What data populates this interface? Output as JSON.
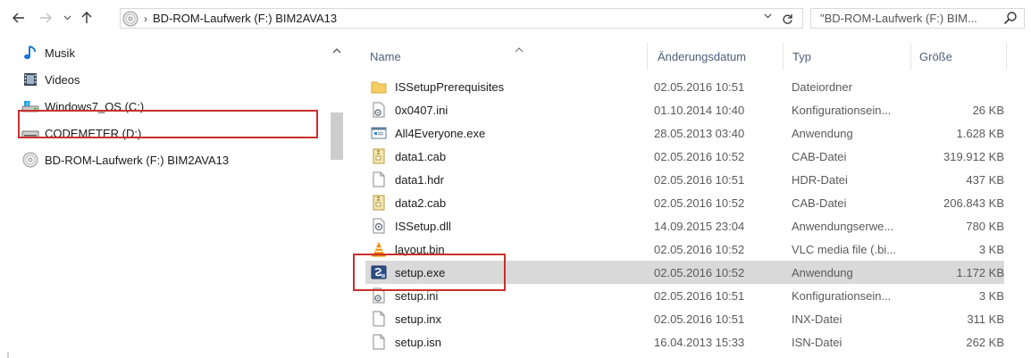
{
  "address_bar": {
    "path": "BD-ROM-Laufwerk (F:) BIM2AVA13",
    "separator": "›"
  },
  "search": {
    "placeholder": "\"BD-ROM-Laufwerk (F:) BIM..."
  },
  "navigation": {
    "items": [
      {
        "label": "Musik",
        "icon": "music-note-icon"
      },
      {
        "label": "Videos",
        "icon": "film-icon"
      },
      {
        "label": "Windows7_OS (C:)",
        "icon": "windows-drive-icon"
      },
      {
        "label": "CODEMETER (D:)",
        "icon": "drive-icon"
      },
      {
        "label": "BD-ROM-Laufwerk (F:) BIM2AVA13",
        "icon": "disc-icon",
        "selected": true
      }
    ]
  },
  "columns": {
    "name": "Name",
    "date": "Änderungsdatum",
    "type": "Typ",
    "size": "Größe"
  },
  "files": [
    {
      "name": "ISSetupPrerequisites",
      "date": "02.05.2016 10:51",
      "type": "Dateiordner",
      "size": "",
      "icon": "folder-icon"
    },
    {
      "name": "0x0407.ini",
      "date": "01.10.2014 10:40",
      "type": "Konfigurationsein...",
      "size": "26 KB",
      "icon": "config-file-icon"
    },
    {
      "name": "All4Everyone.exe",
      "date": "28.05.2013 03:40",
      "type": "Anwendung",
      "size": "1.628 KB",
      "icon": "application-icon"
    },
    {
      "name": "data1.cab",
      "date": "02.05.2016 10:52",
      "type": "CAB-Datei",
      "size": "319.912 KB",
      "icon": "cab-file-icon"
    },
    {
      "name": "data1.hdr",
      "date": "02.05.2016 10:51",
      "type": "HDR-Datei",
      "size": "437 KB",
      "icon": "blank-file-icon"
    },
    {
      "name": "data2.cab",
      "date": "02.05.2016 10:52",
      "type": "CAB-Datei",
      "size": "206.843 KB",
      "icon": "cab-file-icon"
    },
    {
      "name": "ISSetup.dll",
      "date": "14.09.2015 23:04",
      "type": "Anwendungserwe...",
      "size": "780 KB",
      "icon": "dll-file-icon"
    },
    {
      "name": "layout.bin",
      "date": "02.05.2016 10:52",
      "type": "VLC media file (.bi...",
      "size": "3 KB",
      "icon": "vlc-cone-icon"
    },
    {
      "name": "setup.exe",
      "date": "02.05.2016 10:52",
      "type": "Anwendung",
      "size": "1.172 KB",
      "icon": "setup-exe-icon",
      "selected": true
    },
    {
      "name": "setup.ini",
      "date": "02.05.2016 10:51",
      "type": "Konfigurationsein...",
      "size": "3 KB",
      "icon": "config-file-icon"
    },
    {
      "name": "setup.inx",
      "date": "02.05.2016 10:51",
      "type": "INX-Datei",
      "size": "311 KB",
      "icon": "blank-file-icon"
    },
    {
      "name": "setup.isn",
      "date": "16.04.2013 15:33",
      "type": "ISN-Datei",
      "size": "262 KB",
      "icon": "blank-file-icon"
    }
  ],
  "colors": {
    "highlight_box": "#c9302c",
    "selected_row": "#d9d9d9",
    "header_text": "#4c607a"
  }
}
